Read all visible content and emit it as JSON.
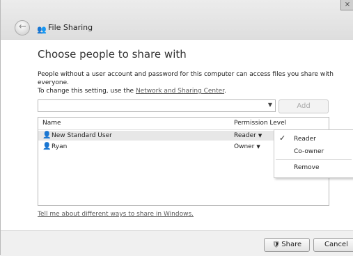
{
  "window": {
    "title": "File Sharing",
    "close_glyph": "⨯",
    "back_glyph": "←"
  },
  "main": {
    "heading": "Choose people to share with",
    "description_line1": "People without a user account and password for this computer can access files you share with everyone.",
    "description_line2_prefix": "To change this setting, use the ",
    "description_link": "Network and Sharing Center",
    "description_line2_suffix": "."
  },
  "picker": {
    "combo_value": "",
    "dropdown_glyph": "▼",
    "add_label": "Add"
  },
  "list": {
    "columns": {
      "name": "Name",
      "permission": "Permission Level"
    },
    "rows": [
      {
        "name": "New Standard User",
        "permission": "Reader",
        "icon": "user-icon"
      },
      {
        "name": "Ryan",
        "permission": "Owner",
        "icon": "user-icon"
      }
    ]
  },
  "context_menu": {
    "items": [
      {
        "label": "Reader",
        "checked": true
      },
      {
        "label": "Co-owner",
        "checked": false
      },
      {
        "label": "Remove",
        "checked": false
      }
    ],
    "check_glyph": "✓"
  },
  "links": {
    "tell_me": "Tell me about different ways to share in Windows."
  },
  "footer": {
    "share_label": "Share",
    "cancel_label": "Cancel"
  }
}
